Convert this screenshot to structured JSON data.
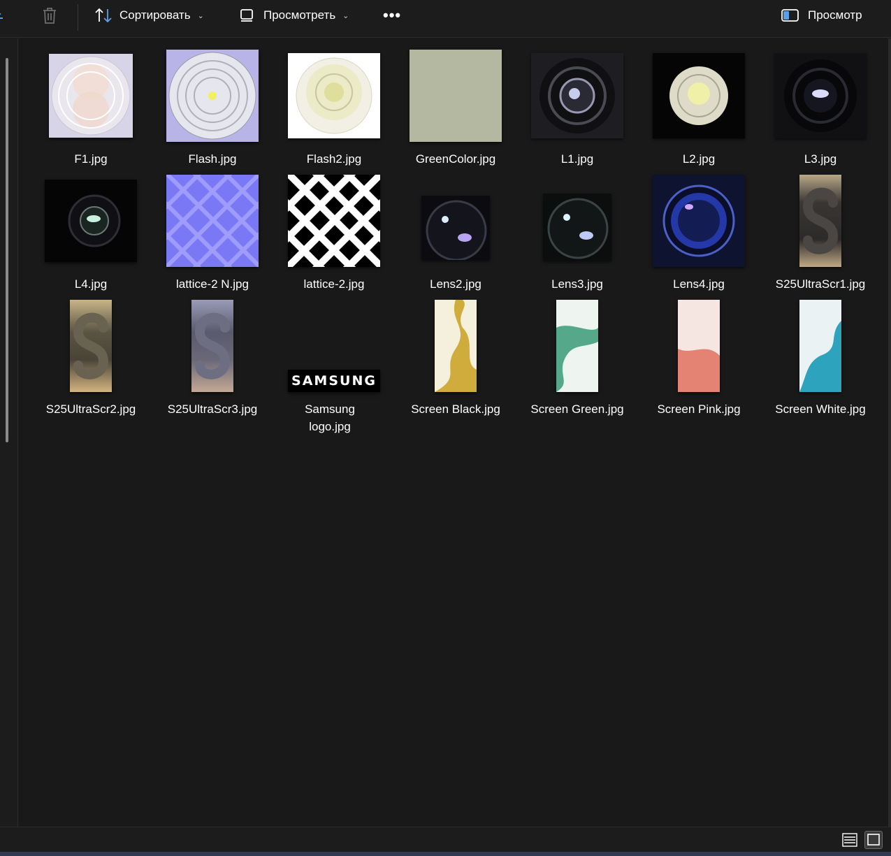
{
  "toolbar": {
    "sort_label": "Сортировать",
    "view_label": "Просмотреть",
    "more_label": "•••",
    "preview_pane_label": "Просмотр"
  },
  "files": [
    {
      "name": "F1.jpg"
    },
    {
      "name": "Flash.jpg"
    },
    {
      "name": "Flash2.jpg"
    },
    {
      "name": "GreenColor.jpg"
    },
    {
      "name": "L1.jpg"
    },
    {
      "name": "L2.jpg"
    },
    {
      "name": "L3.jpg"
    },
    {
      "name": "L4.jpg"
    },
    {
      "name": "lattice-2 N.jpg"
    },
    {
      "name": "lattice-2.jpg"
    },
    {
      "name": "Lens2.jpg"
    },
    {
      "name": "Lens3.jpg"
    },
    {
      "name": "Lens4.jpg"
    },
    {
      "name": "S25UltraScr1.jpg"
    },
    {
      "name": "S25UltraScr2.jpg"
    },
    {
      "name": "S25UltraScr3.jpg"
    },
    {
      "name": "Samsung logo.jpg",
      "thumb_text": "SAMSUNG"
    },
    {
      "name": "Screen Black.jpg"
    },
    {
      "name": "Screen Green.jpg"
    },
    {
      "name": "Screen Pink.jpg"
    },
    {
      "name": "Screen White.jpg"
    }
  ]
}
